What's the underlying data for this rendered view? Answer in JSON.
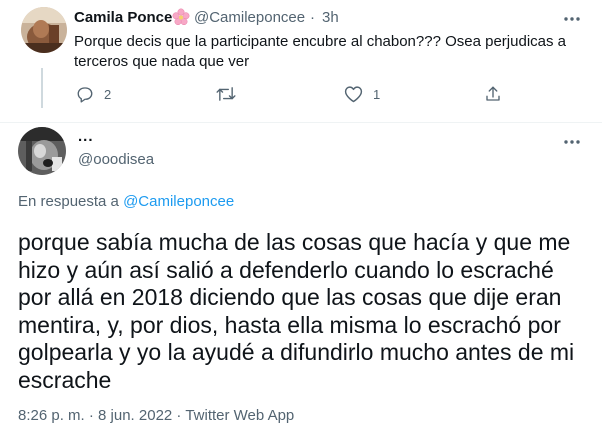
{
  "reply_tweet": {
    "author_name": "Camila Ponce",
    "author_handle": "@Camileponcee",
    "separator": "·",
    "time": "3h",
    "text": "Porque decis que la participante encubre al chabon??? Osea perjudicas a terceros que nada que ver",
    "actions": {
      "reply_count": "2",
      "retweet_count": "",
      "like_count": "1"
    }
  },
  "main_tweet": {
    "author_name": "...",
    "author_handle": "@ooodisea",
    "reply_to_prefix": "En respuesta a",
    "reply_to_handle": "@Camileponcee",
    "text": "porque sabía mucha de las cosas que hacía y que me hizo y aún así salió a defenderlo cuando lo escraché por allá en 2018 diciendo que las cosas que dije eran mentira, y, por dios, hasta ella misma lo escrachó por golpearla y yo la ayudé a difundirlo mucho antes de mi escrache",
    "meta": "8:26 p. m. · 8 jun. 2022 · Twitter Web App"
  },
  "icons": {
    "more": "more-horizontal-icon",
    "reply": "reply-icon",
    "retweet": "retweet-icon",
    "like": "heart-icon",
    "share": "share-icon",
    "emoji": "cherry-blossom-icon"
  },
  "colors": {
    "primary_text": "#0f1419",
    "secondary_text": "#536471",
    "link": "#1d9bf0",
    "divider": "#eff3f4",
    "emoji_pink": "#f7a8c6"
  }
}
